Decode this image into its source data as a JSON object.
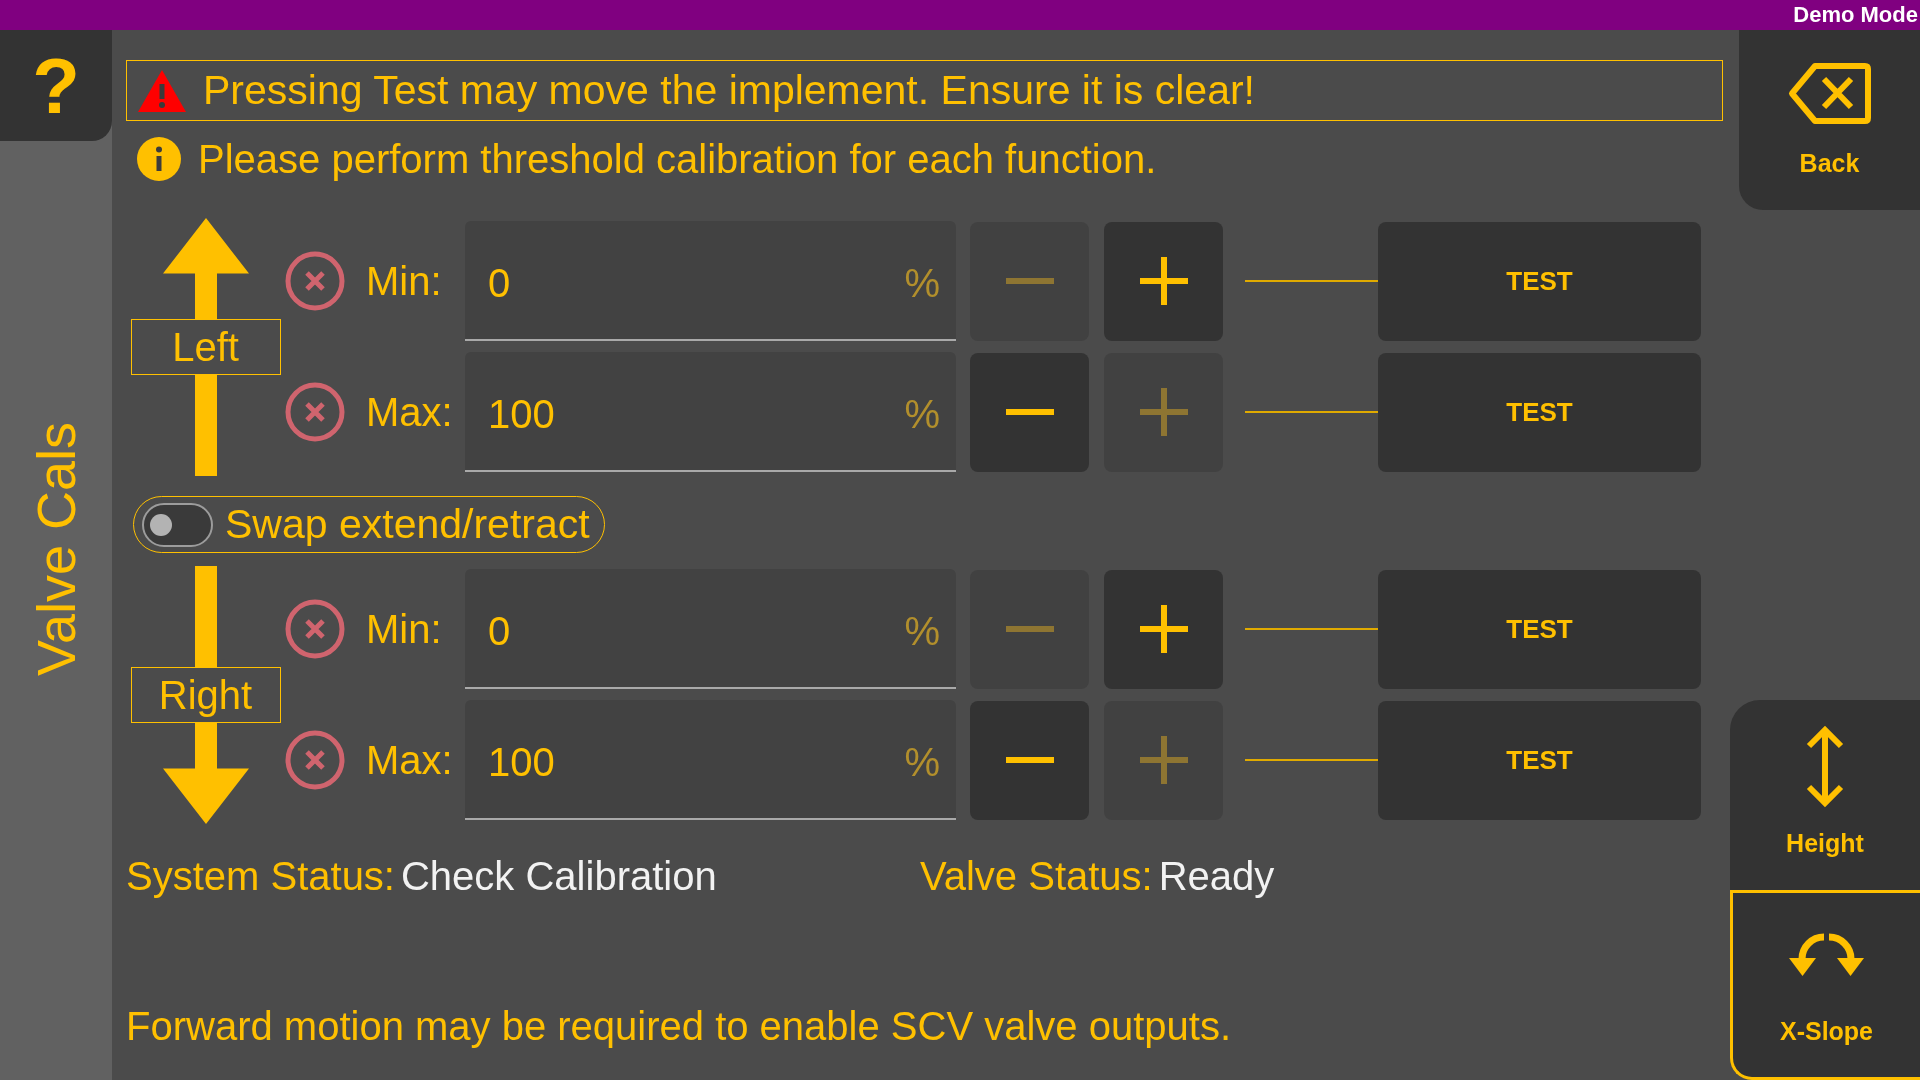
{
  "top_bar": {
    "mode_label": "Demo Mode"
  },
  "help_button": {
    "label": "?"
  },
  "page_title": "Valve Cals",
  "warning": "Pressing Test may move the implement. Ensure it is clear!",
  "info": "Please perform threshold calibration for each function.",
  "calibration": [
    {
      "kind": "function",
      "label": "Left",
      "arrow": {
        "kind": "up"
      },
      "rows": [
        {
          "label": "Min:",
          "value": "0",
          "unit": "%",
          "decrease": {
            "disabled": true
          },
          "increase": {
            "disabled": false
          },
          "test_button": "TEST"
        },
        {
          "label": "Max:",
          "value": "100",
          "unit": "%",
          "decrease": {
            "disabled": false
          },
          "increase": {
            "disabled": true
          },
          "test_button": "TEST"
        }
      ]
    },
    {
      "kind": "toggle",
      "label": "Swap extend/retract",
      "on": false
    },
    {
      "kind": "function",
      "label": "Right",
      "arrow": {
        "kind": "down"
      },
      "rows": [
        {
          "label": "Min:",
          "value": "0",
          "unit": "%",
          "decrease": {
            "disabled": true
          },
          "increase": {
            "disabled": false
          },
          "test_button": "TEST"
        },
        {
          "label": "Max:",
          "value": "100",
          "unit": "%",
          "decrease": {
            "disabled": false
          },
          "increase": {
            "disabled": true
          },
          "test_button": "TEST"
        }
      ]
    }
  ],
  "status": [
    {
      "label": "System Status:",
      "value": "Check Calibration"
    },
    {
      "label": "Valve Status:",
      "value": "Ready"
    }
  ],
  "footer_note": "Forward motion may be required to enable SCV valve outputs.",
  "back_button": {
    "label": "Back"
  },
  "mode_buttons": [
    {
      "label": "Height",
      "kind": "height",
      "selected": false
    },
    {
      "label": "X-Slope",
      "kind": "slope",
      "selected": true
    }
  ]
}
